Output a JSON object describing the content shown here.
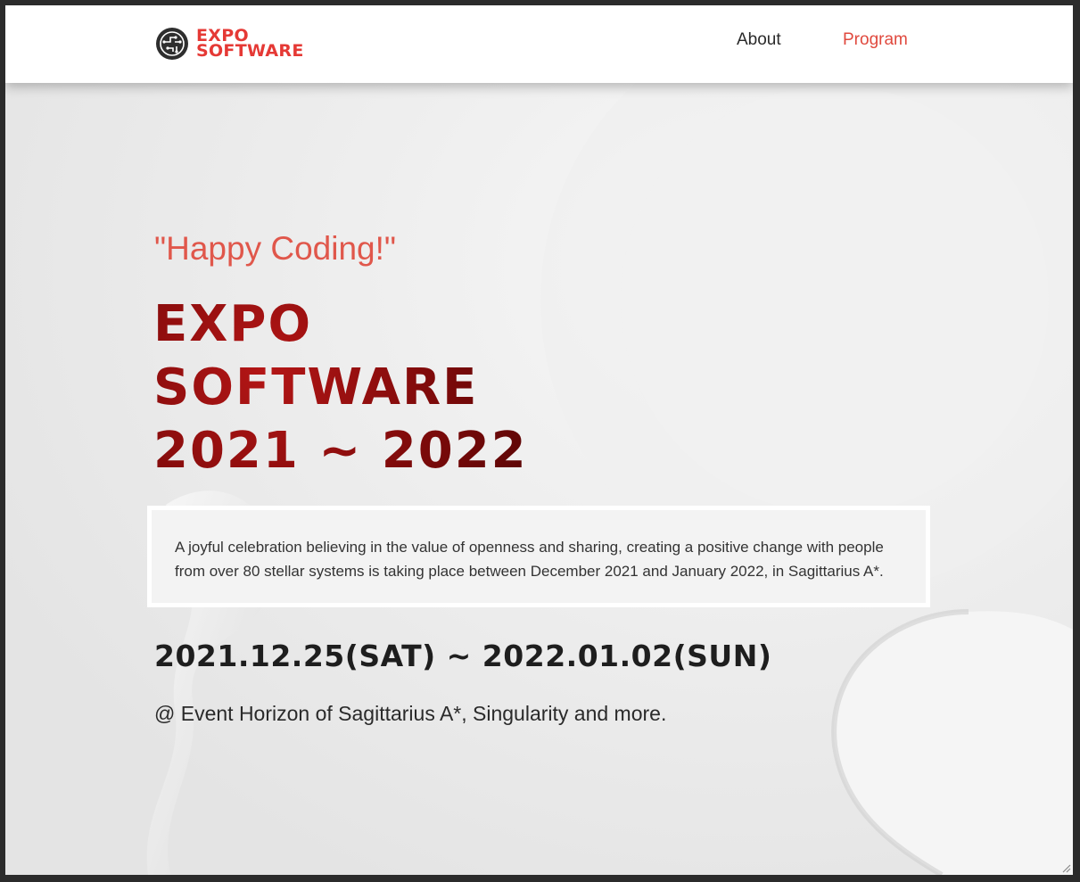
{
  "header": {
    "logo": {
      "line1": "EXPO",
      "line2": "SOFTWARE",
      "icon": "circuit-globe-icon"
    },
    "nav": [
      {
        "label": "About"
      },
      {
        "label": "Program"
      }
    ]
  },
  "hero": {
    "tagline": "\"Happy Coding!\"",
    "title": {
      "line1": "EXPO",
      "line2": "SOFTWARE",
      "line3": "2021 ~ 2022"
    },
    "description": "A joyful celebration believing in the value of openness and sharing, creating a positive change with people from over 80 stellar systems is taking place between December 2021 and January 2022, in Sagittarius A*.",
    "dates": "2021.12.25(SAT) ~ 2022.01.02(SUN)",
    "venue": "@ Event Horizon of Sagittarius A*, Singularity and more."
  },
  "colors": {
    "brand": "#e53935",
    "accent": "#e0574b",
    "title_red": "#8b0d0d",
    "background": "#ececec"
  }
}
